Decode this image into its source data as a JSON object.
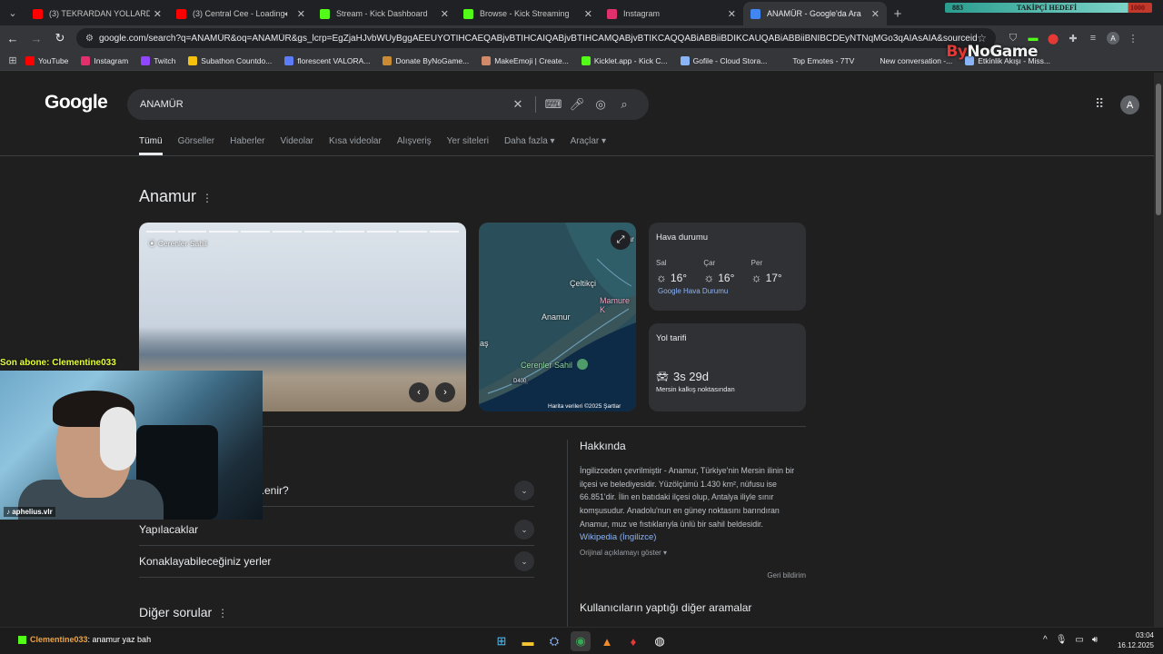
{
  "browser": {
    "tabs": [
      {
        "title": "(3) TEKRARDAN YOLLARDAYIZ!",
        "favicon_color": "#ff0000",
        "active": false,
        "speaker": false
      },
      {
        "title": "(3) Central Cee - Loading [",
        "favicon_color": "#ff0000",
        "active": false,
        "speaker": true
      },
      {
        "title": "Stream - Kick Dashboard",
        "favicon_color": "#53fc18",
        "active": false,
        "speaker": false
      },
      {
        "title": "Browse - Kick Streaming",
        "favicon_color": "#53fc18",
        "active": false,
        "speaker": false
      },
      {
        "title": "Instagram",
        "favicon_color": "#e1306c",
        "active": false,
        "speaker": false
      },
      {
        "title": "ANAMÜR - Google'da Ara",
        "favicon_color": "#4285f4",
        "active": true,
        "speaker": false
      }
    ],
    "url": "google.com/search?q=ANAMÜR&oq=ANAMÜR&gs_lcrp=EgZjaHJvbWUyBggAEEUYOTIHCAEQABjvBTIHCAIQABjvBTIHCAMQABjvBTIKCAQQABiABBiiBDIKCAUQABiABBiiBNIBCDEyNTNqMGo3qAIAsAIA&sourceid=chrome&ie=UTF-8",
    "bookmarks": [
      {
        "label": "YouTube",
        "color": "#ff0000"
      },
      {
        "label": "Instagram",
        "color": "#e1306c"
      },
      {
        "label": "Twitch",
        "color": "#9146ff"
      },
      {
        "label": "Subathon Countdo...",
        "color": "#f4c20d"
      },
      {
        "label": "florescent VALORA...",
        "color": "#5c7cfa"
      },
      {
        "label": "Donate ByNoGame...",
        "color": "#c98c35"
      },
      {
        "label": "MakeEmoji | Create...",
        "color": "#d08a6a"
      },
      {
        "label": "Kicklet.app - Kick C...",
        "color": "#53fc18"
      },
      {
        "label": "Gofile - Cloud Stora...",
        "color": "#8ab4f8"
      },
      {
        "label": "Top Emotes - 7TV",
        "color": "#35363a"
      },
      {
        "label": "New conversation -...",
        "color": "#35363a"
      },
      {
        "label": "Etkinlik Akışı - Miss...",
        "color": "#8ab4f8"
      }
    ]
  },
  "overlay": {
    "follower_goal_current": "883",
    "follower_goal_label": "TAKİPÇİ HEDEFİ",
    "follower_goal_target": "1000",
    "follower_goal_progress": 0.883,
    "brand_by": "By",
    "brand_rest": "NoGame",
    "last_sub": "Son abone: Clementine033",
    "cam_handle": "aphelius.vlr",
    "chat_user": "Clementine033",
    "chat_message": ": anamur yaz bah"
  },
  "google": {
    "logo": "Google",
    "query": "ANAMÜR",
    "tabs": [
      "Tümü",
      "Görseller",
      "Haberler",
      "Videolar",
      "Kısa videolar",
      "Alışveriş",
      "Yer siteleri",
      "Daha fazla ▾",
      "Araçlar ▾"
    ],
    "account_initial": "A",
    "entity_title": "Anamur",
    "photo_location": "Cerenler Sahil",
    "map": {
      "labels": [
        "Çeltikçi",
        "Anamur",
        "Mamure K",
        "Cerenler Sahil",
        "D400",
        "aş",
        "Car"
      ],
      "credits": "Harita verileri ©2025   Şartlar"
    },
    "weather": {
      "title": "Hava durumu",
      "days": [
        {
          "day": "Sal",
          "temp": "16°"
        },
        {
          "day": "Çar",
          "temp": "16°"
        },
        {
          "day": "Per",
          "temp": "17°"
        }
      ],
      "link": "Google Hava Durumu"
    },
    "route": {
      "title": "Yol tarifi",
      "duration": "3s 29d",
      "from": "Mersin kalkış noktasından"
    },
    "accordions": [
      {
        "label": "...enir?"
      },
      {
        "label": "Yapılacaklar"
      },
      {
        "label": "Konaklayabileceğiniz yerler"
      }
    ],
    "other_questions": "Diğer sorular",
    "about": {
      "title": "Hakkında",
      "description": "İngilizceden çevrilmiştir - Anamur, Türkiye'nin Mersin ilinin bir ilçesi ve belediyesidir. Yüzölçümü 1.430 km², nüfusu ise 66.851'dir. İlin en batıdaki ilçesi olup, Antalya iliyle sınır komşusudur. Anadolu'nun en güney noktasını barındıran Anamur, muz ve fıstıklarıyla ünlü bir sahil beldesidir.",
      "wiki_link": "Wikipedia (İngilizce)",
      "show_original": "Orijinal açıklamayı göster ▾",
      "feedback": "Geri bildirim"
    },
    "others_searched": "Kullanıcıların yaptığı diğer aramalar"
  },
  "taskbar": {
    "time": "03:04",
    "date": "16.12.2025"
  }
}
